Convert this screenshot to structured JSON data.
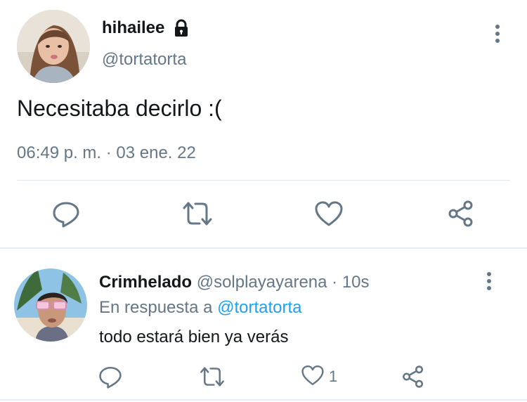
{
  "tweet": {
    "display_name": "hihailee",
    "handle": "@tortatorta",
    "text": "Necesitaba decirlo :(",
    "timestamp": "06:49 p. m. · 03 ene. 22",
    "icons": [
      "lock-icon",
      "more-options-icon",
      "reply-icon",
      "retweet-icon",
      "like-icon",
      "share-icon"
    ]
  },
  "reply": {
    "display_name": "Crimhelado",
    "meta": "@solplayayarena · 10s",
    "replying_prefix": "En respuesta a",
    "replying_handle": "@tortatorta",
    "text": "todo estará bien ya verás",
    "like_count": "1",
    "icons": [
      "more-options-icon",
      "reply-icon",
      "retweet-icon",
      "like-icon",
      "share-icon"
    ]
  },
  "colors": {
    "text_primary": "#14171a",
    "text_secondary": "#657786",
    "link": "#1da1f2",
    "icon": "#657786",
    "divider": "#e1e8ed"
  }
}
